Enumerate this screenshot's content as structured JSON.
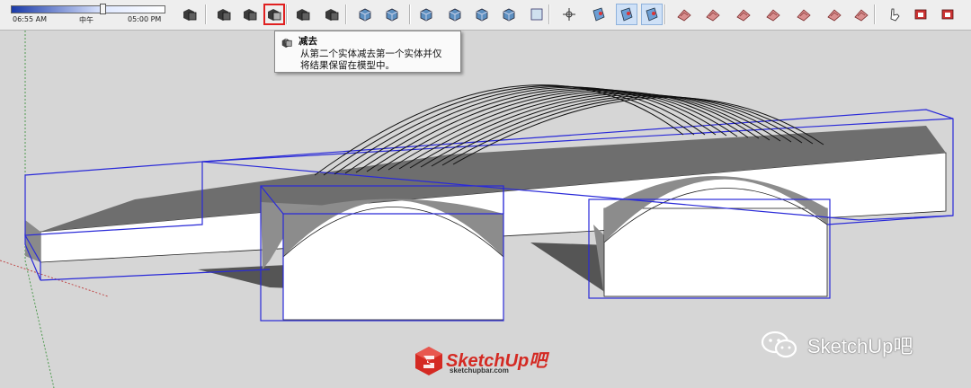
{
  "shadow_settings": {
    "time_start": "06:55 AM",
    "time_mid": "中午",
    "time_end": "05:00 PM",
    "slider_position_fraction": 0.58
  },
  "toolbar": {
    "buttons": [
      {
        "name": "outer-shell-icon"
      },
      {
        "name": "intersect-icon"
      },
      {
        "name": "union-icon"
      },
      {
        "name": "subtract-icon",
        "state": "hovered-highlighted"
      },
      {
        "name": "trim-icon"
      },
      {
        "name": "split-icon"
      },
      {
        "name": "iso-view-icon"
      },
      {
        "name": "top-view-icon"
      },
      {
        "name": "front-view-icon"
      },
      {
        "name": "right-view-icon"
      },
      {
        "name": "back-view-icon"
      },
      {
        "name": "left-view-icon"
      },
      {
        "name": "xray-style-icon"
      },
      {
        "name": "axes-icon"
      },
      {
        "name": "section-plane-icon"
      },
      {
        "name": "display-section-planes-icon",
        "state": "active"
      },
      {
        "name": "display-section-cuts-icon",
        "state": "active"
      },
      {
        "name": "sandbox-from-contours-icon"
      },
      {
        "name": "sandbox-from-scratch-icon"
      },
      {
        "name": "smoove-icon"
      },
      {
        "name": "stamp-icon"
      },
      {
        "name": "drape-icon"
      },
      {
        "name": "add-detail-icon"
      },
      {
        "name": "flip-edge-icon"
      },
      {
        "name": "interact-icon"
      },
      {
        "name": "warehouse-icon"
      },
      {
        "name": "extension-warehouse-icon"
      }
    ]
  },
  "tooltip": {
    "title": "减去",
    "line1": "从第二个实体减去第一个实体并仅",
    "line2": "将结果保留在模型中。"
  },
  "watermark": {
    "brand": "SketchUp吧",
    "url": "sketchupbar.com",
    "wechat_text": "SketchUp吧"
  },
  "colors": {
    "highlight_border": "#e02020",
    "selection_blue": "#2a2ad8",
    "viewport_bg": "#d6d6d6"
  }
}
